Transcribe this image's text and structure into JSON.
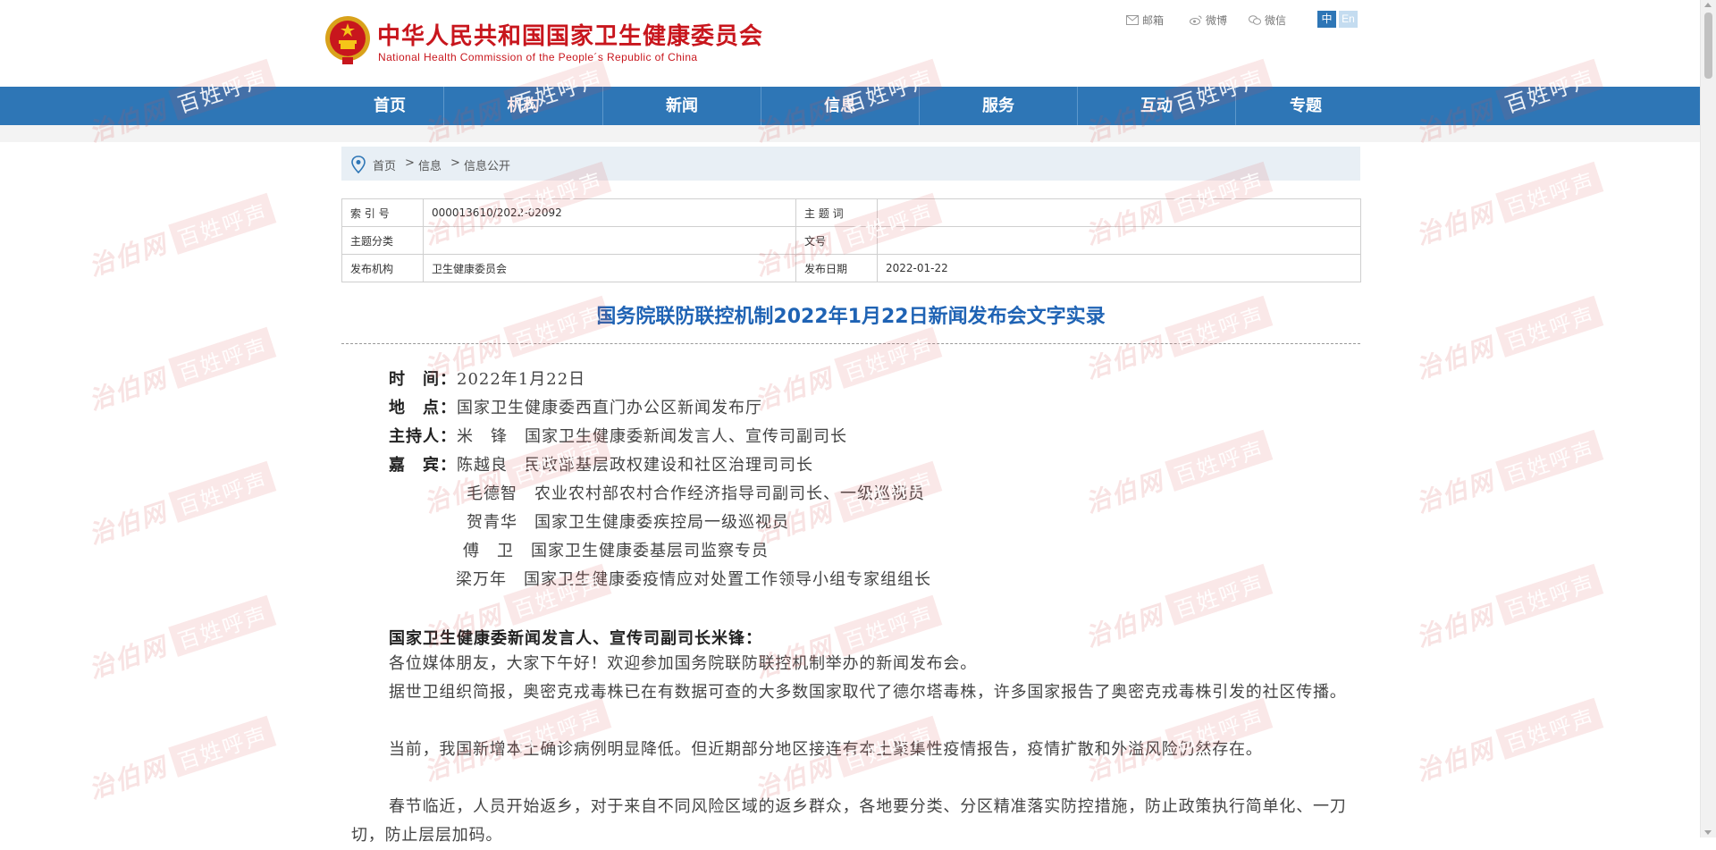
{
  "header": {
    "logo_cn": "中华人民共和国国家卫生健康委员会",
    "logo_en": "National Health Commission of the People´s Republic of China",
    "top_links": {
      "mail": "邮箱",
      "weibo": "微博",
      "wechat": "微信"
    },
    "lang_zh": "中",
    "lang_en": "En"
  },
  "nav": [
    "首页",
    "机构",
    "新闻",
    "信息",
    "服务",
    "互动",
    "专题"
  ],
  "breadcrumb": {
    "home": "首页",
    "sep1": ">",
    "info": "信息",
    "sep2": ">",
    "current": "信息公开"
  },
  "meta": {
    "index_label": "索 引 号",
    "index_value": "000013610/2022-02092",
    "topic_label": "主 题 词",
    "topic_value": "",
    "category_label": "主题分类",
    "category_value": "",
    "docno_label": "文号",
    "docno_value": "",
    "publisher_label": "发布机构",
    "publisher_value": "卫生健康委员会",
    "date_label": "发布日期",
    "date_value": "2022-01-22"
  },
  "article": {
    "title": "国务院联防联控机制2022年1月22日新闻发布会文字实录",
    "time_label": "时　间：",
    "time_value": "2022年1月22日",
    "place_label": "地　点：",
    "place_value": "国家卫生健康委西直门办公区新闻发布厅",
    "host_label": "主持人：",
    "host_value": "米　锋　国家卫生健康委新闻发言人、宣传司副司长",
    "guests_label": "嘉　宾：",
    "guests": [
      "陈越良　民政部基层政权建设和社区治理司司长",
      "毛德智　农业农村部农村合作经济指导司副司长、一级巡视员",
      "贺青华　国家卫生健康委疾控局一级巡视员",
      "傅　卫　国家卫生健康委基层司监察专员",
      "梁万年　国家卫生健康委疫情应对处置工作领导小组专家组组长"
    ],
    "speaker": "国家卫生健康委新闻发言人、宣传司副司长米锋：",
    "paragraphs": [
      "各位媒体朋友，大家下午好！欢迎参加国务院联防联控机制举办的新闻发布会。",
      "据世卫组织简报，奥密克戎毒株已在有数据可查的大多数国家取代了德尔塔毒株，许多国家报告了奥密克戎毒株引发的社区传播。",
      "当前，我国新增本土确诊病例明显降低。但近期部分地区接连有本土聚集性疫情报告，疫情扩散和外溢风险仍然存在。",
      "春节临近，人员开始返乡，对于来自不同风险区域的返乡群众，各地要分类、分区精准落实防控措施，防止政策执行简单化、一刀切，防止层层加码。"
    ]
  },
  "watermark": {
    "script": "治伯网",
    "box": "百姓呼声"
  },
  "colors": {
    "brand_red": "#c8161d",
    "nav_blue": "#2e76b6",
    "title_blue": "#1f63b4"
  }
}
